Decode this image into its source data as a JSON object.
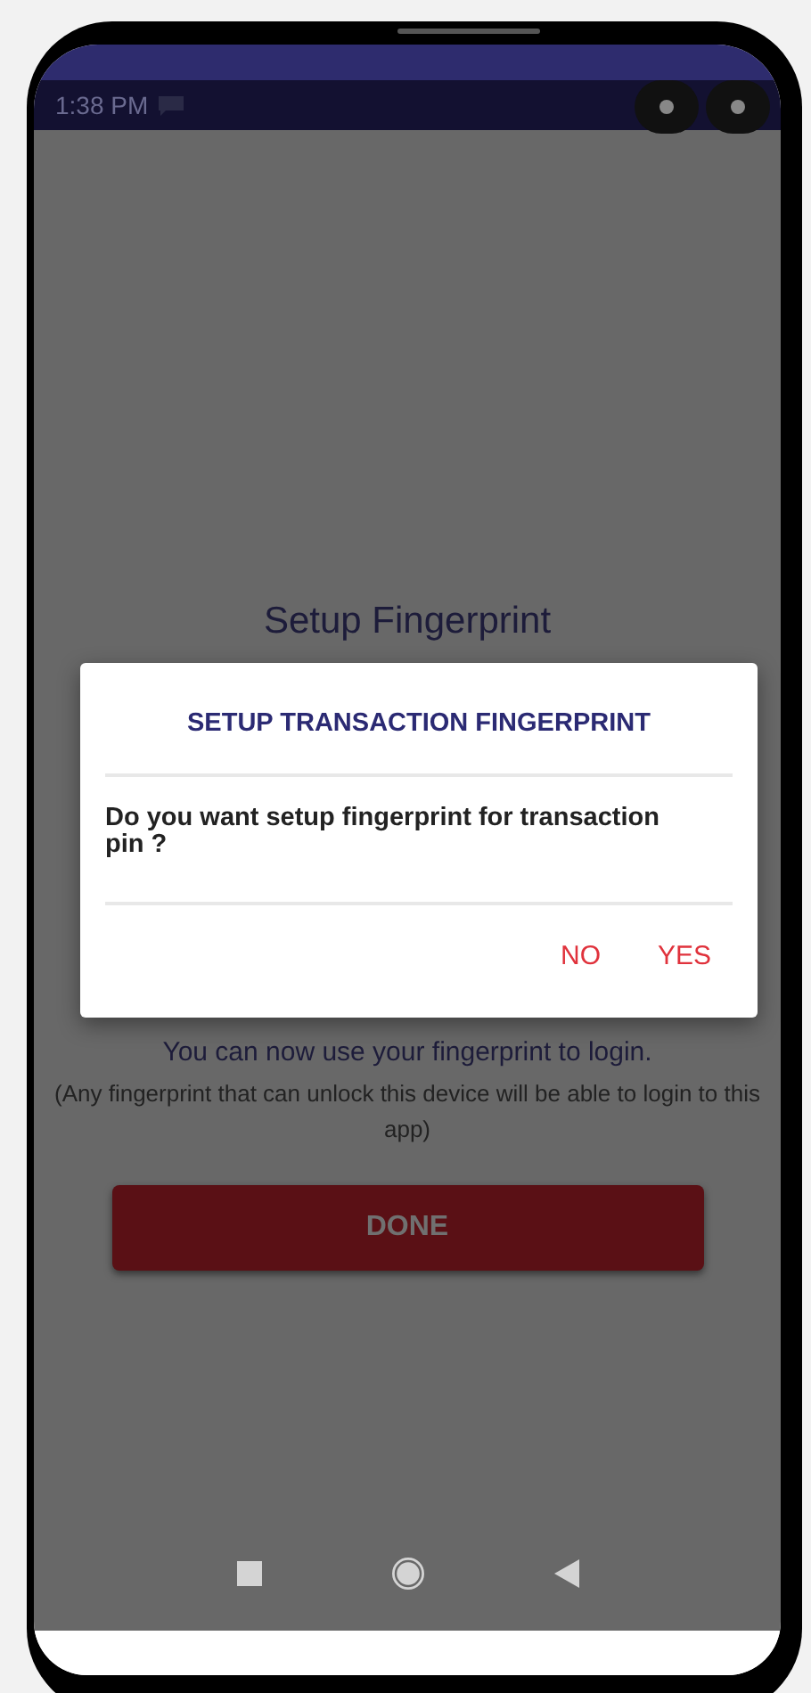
{
  "status_bar": {
    "time": "1:38 PM"
  },
  "screen": {
    "title": "Setup Fingerprint",
    "message": "You can now use your fingerprint to login.",
    "note": "(Any fingerprint that can unlock this device will be able to login to this app)",
    "button": "DONE"
  },
  "dialog": {
    "title": "SETUP TRANSACTION FINGERPRINT",
    "message": "Do you want setup fingerprint for transaction pin ?",
    "buttons": [
      {
        "label": "NO"
      },
      {
        "label": "YES"
      }
    ]
  }
}
